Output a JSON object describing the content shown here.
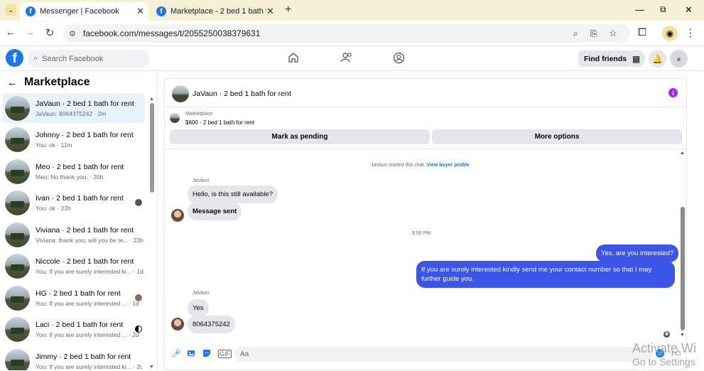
{
  "browser": {
    "tabs": [
      {
        "title": "Messenger | Facebook",
        "active": true
      },
      {
        "title": "Marketplace - 2 bed 1 bath for r",
        "active": false
      }
    ],
    "url": "facebook.com/messages/t/2055250038379631",
    "window_controls": [
      "—",
      "⧉",
      "✕"
    ]
  },
  "fb": {
    "search_placeholder": "Search Facebook",
    "find_friends": "Find friends"
  },
  "left": {
    "title": "Marketplace",
    "conversations": [
      {
        "name": "JaVaun · 2 bed 1 bath for rent",
        "preview": "JaVaun: 8064375242 · 2m",
        "selected": true
      },
      {
        "name": "Johnny · 2 bed 1 bath for rent",
        "preview": "You: ok · 11m"
      },
      {
        "name": "Meo · 2 bed 1 bath for rent",
        "preview": "Meo: No thank you. · 20h"
      },
      {
        "name": "Ivan · 2 bed 1 bath for rent",
        "preview": "You: ok · 22h"
      },
      {
        "name": "Viviana · 2 bed 1 bath for rent",
        "preview": "Viviana: thank you, will you be te... · 23h"
      },
      {
        "name": "Niccole · 2 bed 1 bath for rent",
        "preview": "You: If you are surely interested ki... · 1d"
      },
      {
        "name": "HG · 2 bed 1 bath for rent",
        "preview": "You: If you are surely interested ... · 1d"
      },
      {
        "name": "Laci · 2 bed 1 bath for rent",
        "preview": "You: If you are surely interested ... · 2d"
      },
      {
        "name": "Jimmy · 2 bed 1 bath for rent",
        "preview": "You: If you are surely interested ki... · 2d"
      }
    ]
  },
  "chat": {
    "title": "JaVaun · 2 bed 1 bath for rent",
    "listing_label": "Marketplace",
    "listing_price": "$600 · 2 bed 1 bath for rent",
    "mark_pending": "Mark as pending",
    "more_options": "More options",
    "started_text": "JaVaun started this chat.",
    "view_buyer": "View buyer profile",
    "sender1": "JaVaun",
    "msg1": "Hello, is this still available?",
    "msg2": "Message sent",
    "time": "8:50 PM",
    "msg3": "Yes, are you interested?",
    "msg4": "If you are surely interested kindly send me your contact number so that I may further guide you.",
    "sender2": "JaVaun",
    "msg5": "Yes",
    "msg6": "8064375242",
    "composer_placeholder": "Aa"
  },
  "watermark": {
    "line1": "Activate Wi",
    "line2": "Go to Settings"
  },
  "colors": {
    "brand": "#1877f2",
    "sent_bubble": "#3a55e8",
    "tabbar": "#f5f0d6"
  }
}
